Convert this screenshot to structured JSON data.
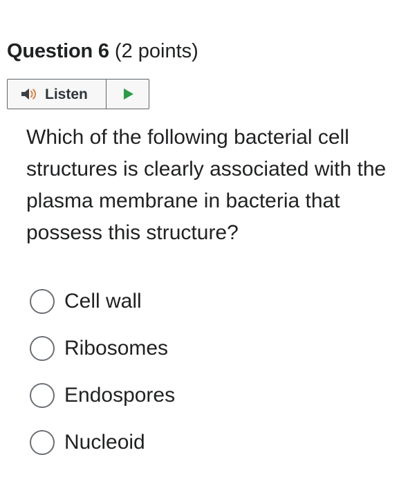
{
  "question": {
    "label": "Question 6",
    "points": "(2 points)",
    "prompt": "Which of the following bacterial cell structures is clearly associated with the plasma membrane in bacteria that possess this structure?"
  },
  "listen": {
    "label": "Listen",
    "speaker_icon": "speaker-icon",
    "play_icon": "play-icon",
    "colors": {
      "speaker_body": "#3b3f46",
      "speaker_waves": "#e07b39",
      "play": "#2a9d45"
    }
  },
  "options": [
    {
      "label": "Cell wall"
    },
    {
      "label": "Ribosomes"
    },
    {
      "label": "Endospores"
    },
    {
      "label": "Nucleoid"
    }
  ]
}
